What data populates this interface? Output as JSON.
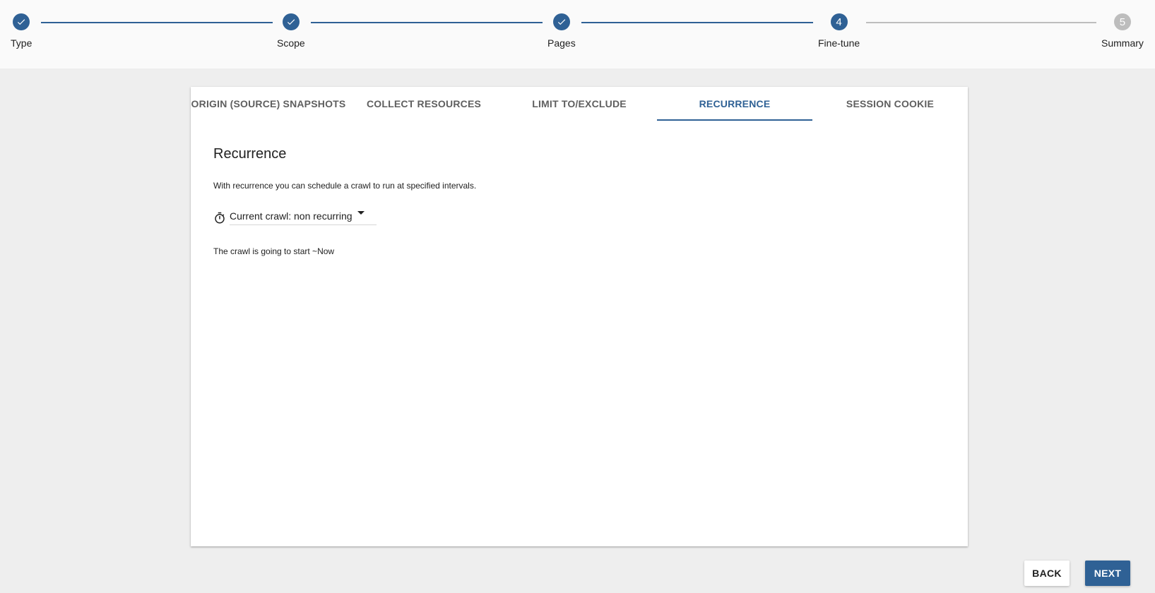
{
  "stepper": {
    "steps": [
      {
        "label": "Type",
        "state": "done",
        "number": "1"
      },
      {
        "label": "Scope",
        "state": "done",
        "number": "2"
      },
      {
        "label": "Pages",
        "state": "done",
        "number": "3"
      },
      {
        "label": "Fine-tune",
        "state": "active",
        "number": "4"
      },
      {
        "label": "Summary",
        "state": "pending",
        "number": "5"
      }
    ]
  },
  "tabs": [
    {
      "label": "ORIGIN (SOURCE) SNAPSHOTS",
      "active": false
    },
    {
      "label": "COLLECT RESOURCES",
      "active": false
    },
    {
      "label": "LIMIT TO/EXCLUDE",
      "active": false
    },
    {
      "label": "RECURRENCE",
      "active": true
    },
    {
      "label": "SESSION COOKIE",
      "active": false
    }
  ],
  "panel": {
    "title": "Recurrence",
    "description": "With recurrence you can schedule a crawl to run at specified intervals.",
    "select_value": "Current crawl: non recurring",
    "start_text": "The crawl is going to start ~Now"
  },
  "footer": {
    "back_label": "BACK",
    "next_label": "NEXT"
  },
  "colors": {
    "primary": "#2f6195",
    "pending": "#bdbdbd",
    "background": "#eeeeee"
  }
}
